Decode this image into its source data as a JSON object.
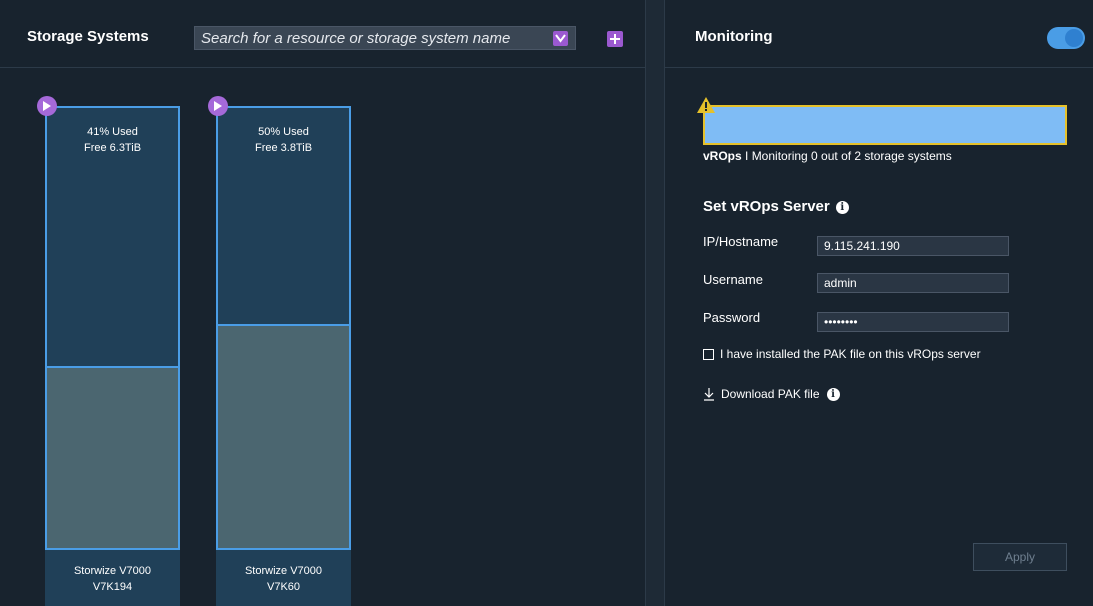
{
  "storage_panel": {
    "title": "Storage Systems",
    "search_placeholder": "Search for a resource or storage system name",
    "systems": [
      {
        "usage": "41% Used",
        "free": "Free 6.3TiB",
        "model": "Storwize V7000",
        "name": "V7K194",
        "used_percent": 41
      },
      {
        "usage": "50% Used",
        "free": "Free 3.8TiB",
        "model": "Storwize V7000",
        "name": "V7K60",
        "used_percent": 50
      }
    ]
  },
  "monitoring_panel": {
    "title": "Monitoring",
    "toggle_on": true,
    "status_prefix": "vROps",
    "status_text": " I Monitoring 0 out of 2 storage systems",
    "section_title": "Set vROps Server",
    "fields": {
      "ip_label": "IP/Hostname",
      "ip_value": "9.115.241.190",
      "username_label": "Username",
      "username_value": "admin",
      "password_label": "Password",
      "password_value": "password"
    },
    "checkbox_label": "I have installed the PAK file on this vROps server",
    "download_label": "Download PAK file",
    "apply_label": "Apply"
  },
  "colors": {
    "accent": "#9b59d0",
    "border_blue": "#4a9de6",
    "warning": "#e6c12a",
    "banner": "#7fbcf5"
  }
}
